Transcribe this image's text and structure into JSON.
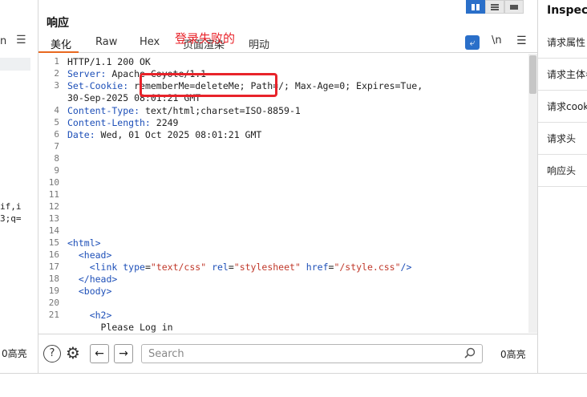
{
  "left_panel": {
    "tab_fragment": "n",
    "code_fragments": [
      "if,i",
      "3;q="
    ],
    "highlight_count": "0高亮"
  },
  "response": {
    "title": "响应",
    "tabs": [
      "美化",
      "Raw",
      "Hex",
      "页面渲染",
      "明动"
    ],
    "annotation": "登录失败的",
    "newline_toggle": "\\n",
    "gutter": [
      "1",
      "2",
      "3",
      "",
      "4",
      "5",
      "6",
      "7",
      "8",
      "9",
      "10",
      "11",
      "12",
      "13",
      "14",
      "15",
      "16",
      "17",
      "18",
      "19",
      "20",
      "21",
      ""
    ],
    "lines": {
      "l1": "HTTP/1.1 200 OK",
      "l2_key": "Server:",
      "l2_val": " Apache-Coyote/1.1",
      "l3_key": "Set-Cookie:",
      "l3_val": " rememberMe=deleteMe; Path=/; Max-Age=0; Expires=Tue,",
      "l3_cont": "30-Sep-2025 08:01:21 GMT",
      "l4_key": "Content-Type:",
      "l4_val": " text/html;charset=ISO-8859-1",
      "l5_key": "Content-Length:",
      "l5_val": " 2249",
      "l6_key": "Date:",
      "l6_val": " Wed, 01 Oct 2025 08:01:21 GMT",
      "l15": "<html>",
      "l16": "  <head>",
      "l17_open": "    <link ",
      "l17_a1": "type",
      "l17_v1": "\"text/css\"",
      "l17_a2": " rel",
      "l17_v2": "\"stylesheet\"",
      "l17_a3": " href",
      "l17_v3": "\"/style.css\"",
      "l17_close": "/>",
      "l18": "  </head>",
      "l19": "  <body>",
      "l21": "    <h2>",
      "l22": "      Please Log in"
    },
    "search": {
      "placeholder": "Search"
    },
    "highlight_count": "0高亮"
  },
  "inspector": {
    "title": "Inspector",
    "items": [
      "请求属性",
      "请求主体参数",
      "请求cookie",
      "请求头",
      "响应头"
    ]
  },
  "colors": {
    "accent": "#e8691f",
    "annotation": "#e8232a",
    "toggle_active": "#2a6fc9"
  }
}
